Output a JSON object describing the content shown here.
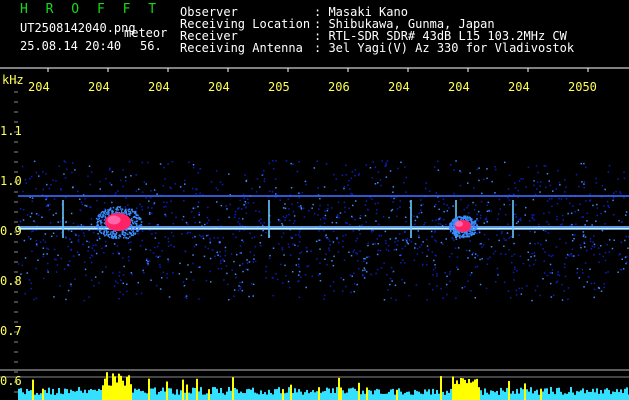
{
  "header": {
    "app_title": "H R O F F T",
    "filename": "UT2508142040.png",
    "tag": "meteor",
    "datetime": "25.08.14 20:40",
    "seconds": "56.",
    "info_labels": [
      "Observer",
      "Receiving Location",
      "Receiver",
      "Receiving Antenna"
    ],
    "info_values": [
      ": Masaki Kano",
      ": Shibukawa, Gunma, Japan",
      ": RTL-SDR SDR# 43dB L15 103.2MHz CW",
      ": 3el Yagi(V) Az 330 for Vladivostok"
    ]
  },
  "axis": {
    "unit": "kHz",
    "x_ticks": [
      "204",
      "204",
      "204",
      "204",
      "205",
      "206",
      "204",
      "204",
      "204",
      "2050"
    ],
    "y_ticks": [
      "1.1",
      "1.0",
      "0.9",
      "0.8",
      "0.7",
      "0.6"
    ]
  },
  "colors": {
    "background": "#000000",
    "title": "#19d819",
    "axis_text": "#ffff55",
    "noise_low": "#0a1fbf",
    "noise_mid": "#3b8cff",
    "hot": "#ff2266",
    "meter_cyan": "#33e0ff",
    "meter_yellow": "#ffff00"
  }
}
